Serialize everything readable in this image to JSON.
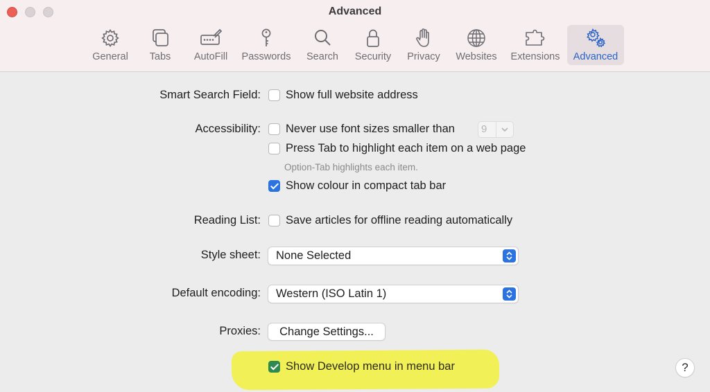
{
  "window": {
    "title": "Advanced"
  },
  "toolbar": {
    "tabs": [
      {
        "label": "General",
        "icon": "gear-icon"
      },
      {
        "label": "Tabs",
        "icon": "tabs-icon"
      },
      {
        "label": "AutoFill",
        "icon": "autofill-icon"
      },
      {
        "label": "Passwords",
        "icon": "key-icon"
      },
      {
        "label": "Search",
        "icon": "magnifier-icon"
      },
      {
        "label": "Security",
        "icon": "lock-icon"
      },
      {
        "label": "Privacy",
        "icon": "hand-icon"
      },
      {
        "label": "Websites",
        "icon": "globe-icon"
      },
      {
        "label": "Extensions",
        "icon": "puzzle-icon"
      },
      {
        "label": "Advanced",
        "icon": "gears-icon",
        "active": true
      }
    ],
    "active_color": "#2b63c6"
  },
  "smart_search": {
    "label": "Smart Search Field:",
    "show_full_address": {
      "label": "Show full website address",
      "checked": false
    }
  },
  "accessibility": {
    "label": "Accessibility:",
    "min_font": {
      "label": "Never use font sizes smaller than",
      "checked": false,
      "size_value": "9"
    },
    "press_tab": {
      "label": "Press Tab to highlight each item on a web page",
      "checked": false
    },
    "hint": "Option-Tab highlights each item.",
    "compact_colour": {
      "label": "Show colour in compact tab bar",
      "checked": true
    }
  },
  "reading_list": {
    "label": "Reading List:",
    "save_offline": {
      "label": "Save articles for offline reading automatically",
      "checked": false
    }
  },
  "style_sheet": {
    "label": "Style sheet:",
    "value": "None Selected"
  },
  "encoding": {
    "label": "Default encoding:",
    "value": "Western (ISO Latin 1)"
  },
  "proxies": {
    "label": "Proxies:",
    "button": "Change Settings..."
  },
  "develop": {
    "label": "Show Develop menu in menu bar",
    "checked": true,
    "highlight_color": "#f2f04a"
  },
  "help": {
    "label": "?"
  }
}
